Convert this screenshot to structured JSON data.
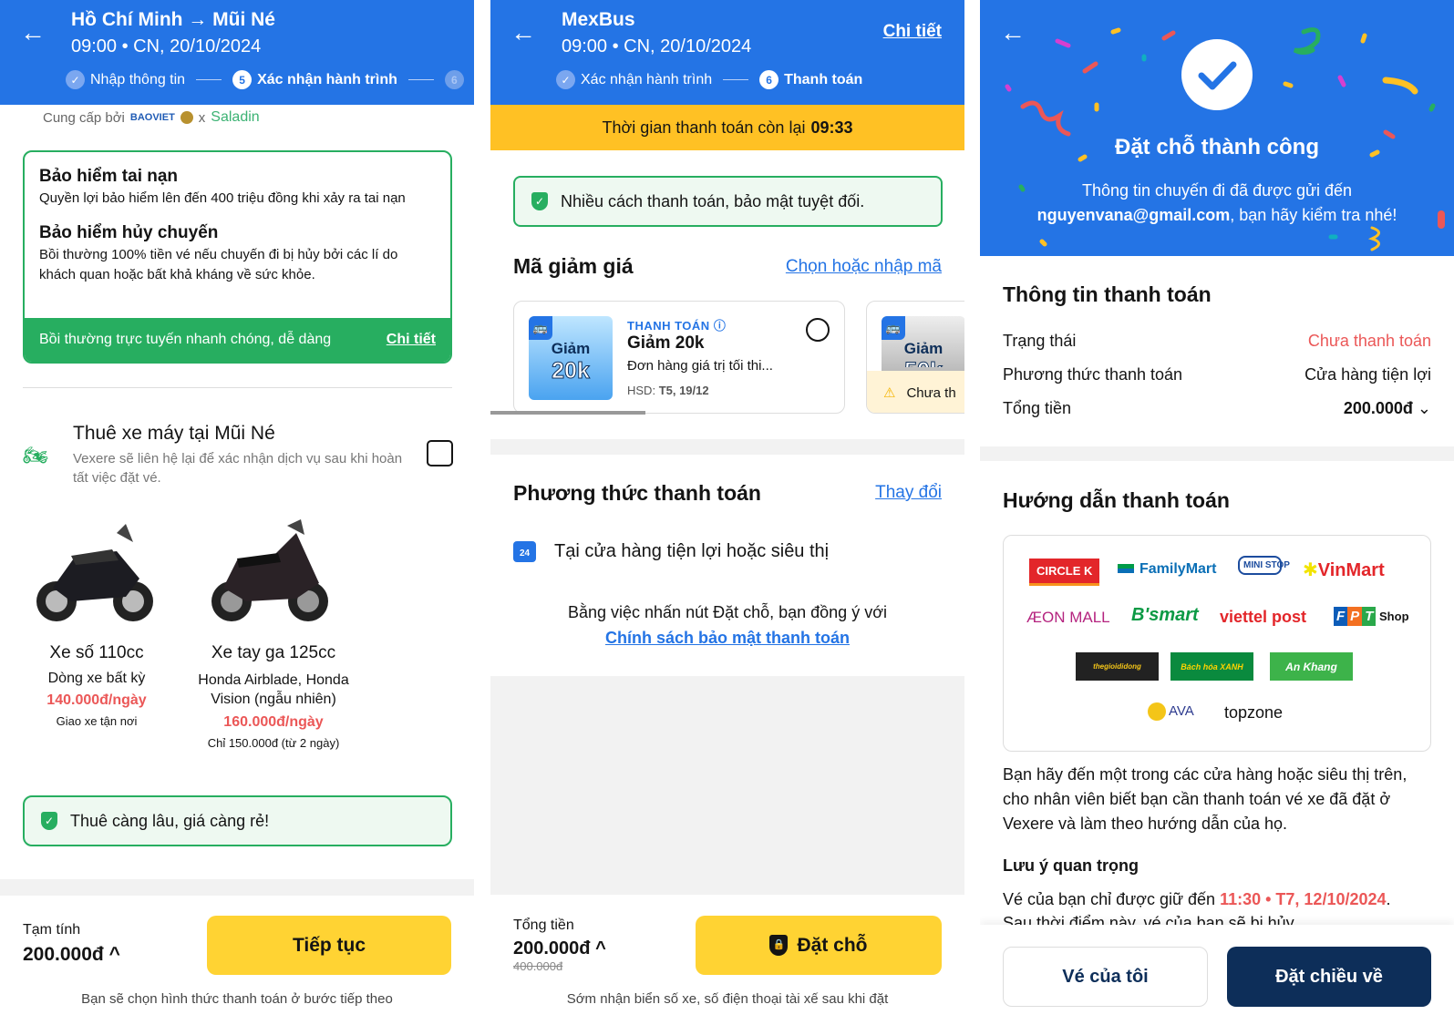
{
  "panel1": {
    "header": {
      "title": "Hồ Chí Minh → Mũi Né",
      "subtitle": "09:00 • CN, 20/10/2024",
      "steps": [
        {
          "label": "Nhập thông tin",
          "state": "done"
        },
        {
          "num": "5",
          "label": "Xác nhận hành trình",
          "state": "current"
        },
        {
          "num": "6",
          "label": "",
          "state": "next"
        }
      ]
    },
    "provider": {
      "label": "Cung cấp bởi",
      "brand1": "BAOVIET",
      "sep": "x",
      "brand2": "Saladin"
    },
    "insurance": {
      "items": [
        {
          "title": "Bảo hiểm tai nạn",
          "desc": "Quyền lợi bảo hiểm lên đến 400 triệu đồng khi xảy ra tai nạn"
        },
        {
          "title": "Bảo hiểm hủy chuyến",
          "desc": "Bồi thường 100% tiền vé nếu chuyến đi bị hủy bởi các lí do khách quan hoặc bất khả kháng về sức khỏe."
        }
      ],
      "footer": "Bồi thường trực tuyến nhanh chóng, dễ dàng",
      "detail_link": "Chi tiết"
    },
    "rental": {
      "title": "Thuê xe máy tại Mũi Né",
      "desc": "Vexere sẽ liên hệ lại để xác nhận dịch vụ sau khi hoàn tất việc đặt vé.",
      "checked": false,
      "bikes": [
        {
          "name": "Xe số 110cc",
          "model": "Dòng xe bất kỳ",
          "price": "140.000đ/ngày",
          "note": "Giao xe tận nơi"
        },
        {
          "name": "Xe tay ga 125cc",
          "model": "Honda Airblade, Honda Vision (ngẫu nhiên)",
          "price": "160.000đ/ngày",
          "note": "Chỉ 150.000đ (từ 2 ngày)"
        }
      ],
      "promo": "Thuê càng lâu, giá càng rẻ!"
    },
    "footer": {
      "label": "Tạm tính",
      "total": "200.000đ",
      "button": "Tiếp tục",
      "note": "Bạn sẽ chọn hình thức thanh toán ở bước tiếp theo"
    }
  },
  "panel2": {
    "header": {
      "title": "MexBus",
      "subtitle": "09:00 • CN, 20/10/2024",
      "detail_link": "Chi tiết",
      "steps": [
        {
          "label": "Xác nhận hành trình",
          "state": "done"
        },
        {
          "num": "6",
          "label": "Thanh toán",
          "state": "current"
        }
      ]
    },
    "timer": {
      "label": "Thời gian thanh toán còn lại",
      "value": "09:33"
    },
    "secure": "Nhiều cách thanh toán, bảo mật tuyệt đối.",
    "coupon": {
      "title": "Mã giảm giá",
      "link": "Chọn hoặc nhập mã",
      "cards": [
        {
          "image_text1": "Giảm",
          "image_text2": "20k",
          "tag": "THANH TOÁN",
          "title": "Giảm 20k",
          "desc": "Đơn hàng giá trị tối thi...",
          "expiry_label": "HSD:",
          "expiry": "T5, 19/12"
        },
        {
          "image_text1": "Giảm",
          "image_text2": "50k",
          "warning": "Chưa th"
        }
      ]
    },
    "payment": {
      "title": "Phương thức thanh toán",
      "link": "Thay đổi",
      "method": "Tại cửa hàng tiện lợi hoặc siêu thị",
      "agree": "Bằng việc nhấn nút Đặt chỗ, bạn đồng ý với",
      "policy": "Chính sách bảo mật thanh toán"
    },
    "footer": {
      "label": "Tổng tiền",
      "total": "200.000đ",
      "original": "400.000đ",
      "button": "Đặt chỗ",
      "note": "Sớm nhận biển số xe, số điện thoại tài xế sau khi đặt"
    }
  },
  "panel3": {
    "success": {
      "title": "Đặt chỗ thành công",
      "line1": "Thông tin chuyến đi đã được gửi đến",
      "email": "nguyenvana@gmail.com",
      "line2": ", bạn hãy kiểm tra nhé!"
    },
    "info": {
      "title": "Thông tin thanh toán",
      "rows": [
        {
          "label": "Trạng thái",
          "value": "Chưa thanh toán"
        },
        {
          "label": "Phương thức thanh toán",
          "value": "Cửa hàng tiện lợi"
        },
        {
          "label": "Tổng tiền",
          "value": "200.000đ"
        }
      ]
    },
    "guide": {
      "title": "Hướng dẫn thanh toán",
      "stores": [
        "CIRCLE K",
        "FamilyMart",
        "MINI STOP",
        "VinMart",
        "ÆON MALL",
        "B'smart",
        "viettel post",
        "FPT Shop",
        "thegioididong",
        "Bách hóa XANH",
        "An Khang",
        "AVA",
        "topzone"
      ],
      "text": "Bạn hãy đến một trong các cửa hàng hoặc siêu thị trên, cho nhân viên biết bạn cần thanh toán vé xe đã đặt ở Vexere và làm theo hướng dẫn của họ.",
      "note_title": "Lưu ý quan trọng",
      "note_pre": "Vé của bạn chỉ được giữ đến",
      "deadline": "11:30 • T7, 12/10/2024",
      "note_post": ".",
      "note_cut": "Sau thời điểm này, vé của bạn sẽ bị hủy"
    },
    "buttons": {
      "my_tickets": "Vé của tôi",
      "return_trip": "Đặt chiều về"
    }
  },
  "colors": {
    "primary": "#2474E5",
    "green": "#27AE60",
    "yellow": "#FFD333",
    "timer": "#FFC124",
    "red": "#EB5757",
    "navy": "#0D2E59"
  }
}
